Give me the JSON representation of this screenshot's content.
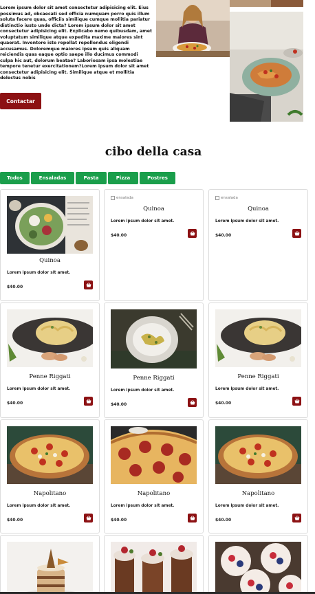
{
  "hero": {
    "text": "Lorem ipsum dolor sit amet consectetur adipisicing elit. Eius possimus ad, obcaecati sed officia numquam porro quis illum soluta facere quas, officiis similique cumque mollitia pariatur distinctio iusto unde dicta? Lorem ipsum dolor sit amet consectetur adipisicing elit. Explicabo nemo quibusdam, amet voluptatum similique atque expedita maxime maiores sint quaerat. Inventore iste repellat repellendus eligendi accusamus. Doloremque maiores ipsum quis aliquam reiciendis quas eaque optio saepe illo ducimus commodi culpa hic aut, dolorum beatae? Laboriosam ipsa molestiae tempore tenetur exercitationem?Lorem ipsum dolor sit amet consectetur adipisicing elit. Similique atque et mollitia delectus nobis",
    "button_label": "Contactar"
  },
  "section": {
    "title": "cibo della casa"
  },
  "filters": [
    "Todos",
    "Ensaladas",
    "Pasta",
    "Pizza",
    "Postres"
  ],
  "products": [
    {
      "name": "Quinoa",
      "desc": "Lorem ipsum dolor sit amet.",
      "price": "$40.00",
      "image": "salad-bowl"
    },
    {
      "name": "Quinoa",
      "desc": "Lorem ipsum dolor sit amet.",
      "price": "$40.00",
      "image": "broken",
      "alt": "ensalada"
    },
    {
      "name": "Quinoa",
      "desc": "Lorem ipsum dolor sit amet.",
      "price": "$40.00",
      "image": "broken",
      "alt": "ensalada"
    },
    {
      "name": "Penne Riggati",
      "desc": "Lorem ipsum dolor sit amet.",
      "price": "$40.00",
      "image": "pasta-plate"
    },
    {
      "name": "Penne Riggati",
      "desc": "Lorem ipsum dolor sit amet.",
      "price": "$40.00",
      "image": "pasta-bowl"
    },
    {
      "name": "Penne Riggati",
      "desc": "Lorem ipsum dolor sit amet.",
      "price": "$40.00",
      "image": "pasta-plate"
    },
    {
      "name": "Napolitano",
      "desc": "Lorem ipsum dolor sit amet.",
      "price": "$40.00",
      "image": "pizza"
    },
    {
      "name": "Napolitano",
      "desc": "Lorem ipsum dolor sit amet.",
      "price": "$40.00",
      "image": "pizza-pepperoni"
    },
    {
      "name": "Napolitano",
      "desc": "Lorem ipsum dolor sit amet.",
      "price": "$40.00",
      "image": "pizza"
    },
    {
      "name": "",
      "desc": "",
      "price": "",
      "image": "cake"
    },
    {
      "name": "",
      "desc": "",
      "price": "",
      "image": "mousse"
    },
    {
      "name": "",
      "desc": "",
      "price": "",
      "image": "cupcakes"
    }
  ],
  "colors": {
    "accent": "#8c1113",
    "filter": "#1a9e4b",
    "border": "#dcdcdc"
  },
  "icons": {
    "cart": "shopping-basket-icon"
  }
}
